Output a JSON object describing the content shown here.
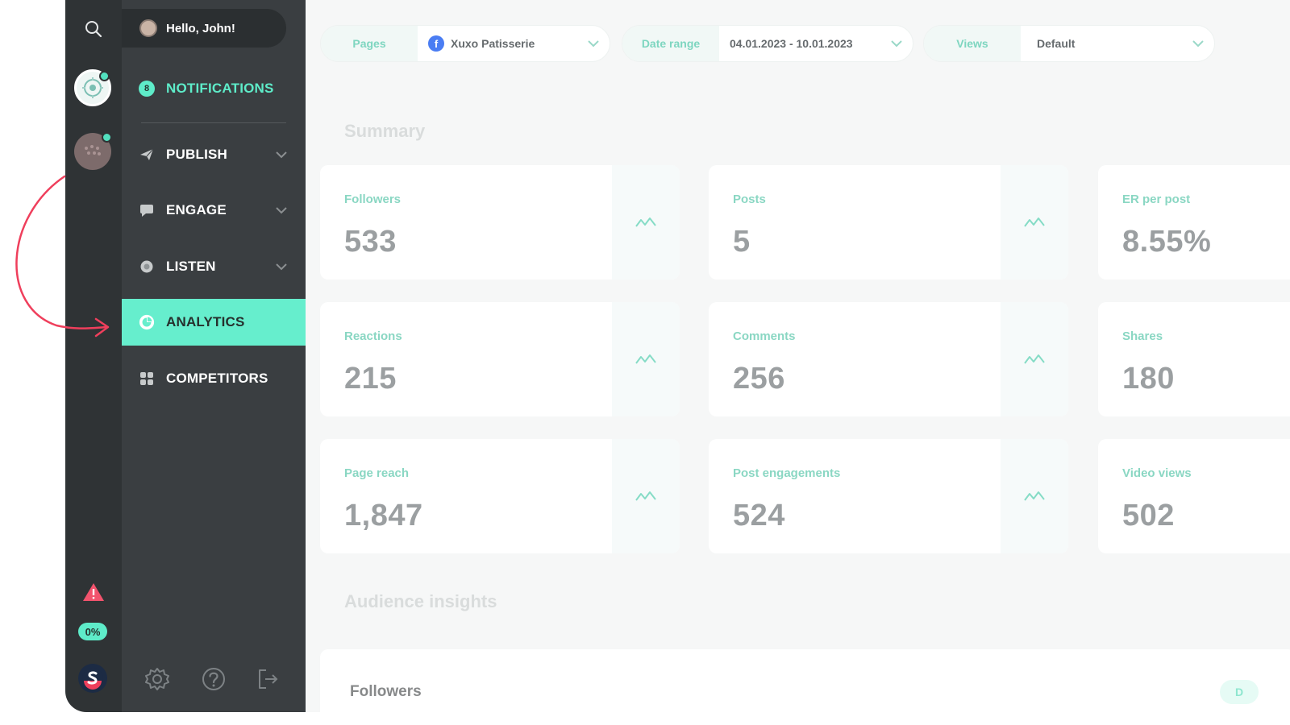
{
  "user": {
    "greeting": "Hello, John!"
  },
  "rail": {
    "progress_badge": "0%"
  },
  "nav": {
    "notifications": {
      "label": "NOTIFICATIONS",
      "badge": "8"
    },
    "items": [
      {
        "label": "PUBLISH",
        "has_chevron": true
      },
      {
        "label": "ENGAGE",
        "has_chevron": true
      },
      {
        "label": "LISTEN",
        "has_chevron": true
      },
      {
        "label": "ANALYTICS",
        "active": true
      },
      {
        "label": "COMPETITORS"
      }
    ]
  },
  "filters": {
    "pages": {
      "tag": "Pages",
      "value": "Xuxo Patisserie"
    },
    "date_range": {
      "tag": "Date range",
      "value": "04.01.2023 - 10.01.2023"
    },
    "views": {
      "tag": "Views",
      "value": "Default"
    }
  },
  "summary": {
    "title": "Summary",
    "metrics": [
      {
        "label": "Followers",
        "value": "533"
      },
      {
        "label": "Posts",
        "value": "5"
      },
      {
        "label": "ER per post",
        "value": "8.55%"
      },
      {
        "label": "Reactions",
        "value": "215"
      },
      {
        "label": "Comments",
        "value": "256"
      },
      {
        "label": "Shares",
        "value": "180"
      },
      {
        "label": "Page reach",
        "value": "1,847"
      },
      {
        "label": "Post engagements",
        "value": "524"
      },
      {
        "label": "Video views",
        "value": "502"
      }
    ]
  },
  "audience": {
    "title": "Audience insights",
    "followers_title": "Followers",
    "period_pill": "D"
  },
  "colors": {
    "accent": "#66eecd",
    "rail": "#2f3335",
    "nav": "#3a3e41",
    "annotation_arrow": "#ef3f5c"
  }
}
